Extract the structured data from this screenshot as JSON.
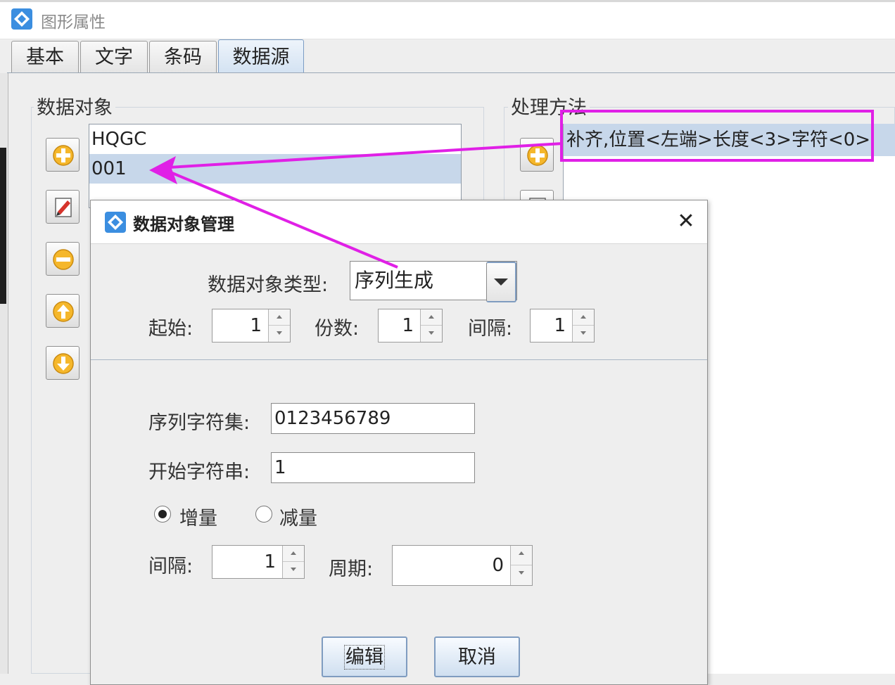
{
  "window": {
    "title": "图形属性"
  },
  "tabs": [
    {
      "label": "基本",
      "active": false
    },
    {
      "label": "文字",
      "active": false
    },
    {
      "label": "条码",
      "active": false
    },
    {
      "label": "数据源",
      "active": true
    }
  ],
  "data_objects": {
    "label": "数据对象",
    "items": [
      "HQGC",
      "001"
    ],
    "selected": "001"
  },
  "processing": {
    "label": "处理方法",
    "items": [
      "补齐,位置<左端>长度<3>字符<0>"
    ]
  },
  "toolbar_icons": [
    "add-icon",
    "edit-icon",
    "remove-icon",
    "move-up-icon",
    "move-down-icon"
  ],
  "dialog": {
    "title": "数据对象管理",
    "close": "✕",
    "type_label": "数据对象类型:",
    "type_value": "序列生成",
    "start_label": "起始:",
    "start_value": "1",
    "copies_label": "份数:",
    "copies_value": "1",
    "interval_label": "间隔:",
    "interval_value": "1",
    "charset_label": "序列字符集:",
    "charset_value": "0123456789",
    "start_string_label": "开始字符串:",
    "start_string_value": "1",
    "increment_label": "增量",
    "decrement_label": "减量",
    "increment_selected": true,
    "step_label": "间隔:",
    "step_value": "1",
    "period_label": "周期:",
    "period_value": "0",
    "edit_button": "编辑",
    "cancel_button": "取消"
  },
  "colors": {
    "annotation": "#e020e6",
    "selection": "#c7d7ea",
    "active_tab": "#d3e2f2"
  }
}
